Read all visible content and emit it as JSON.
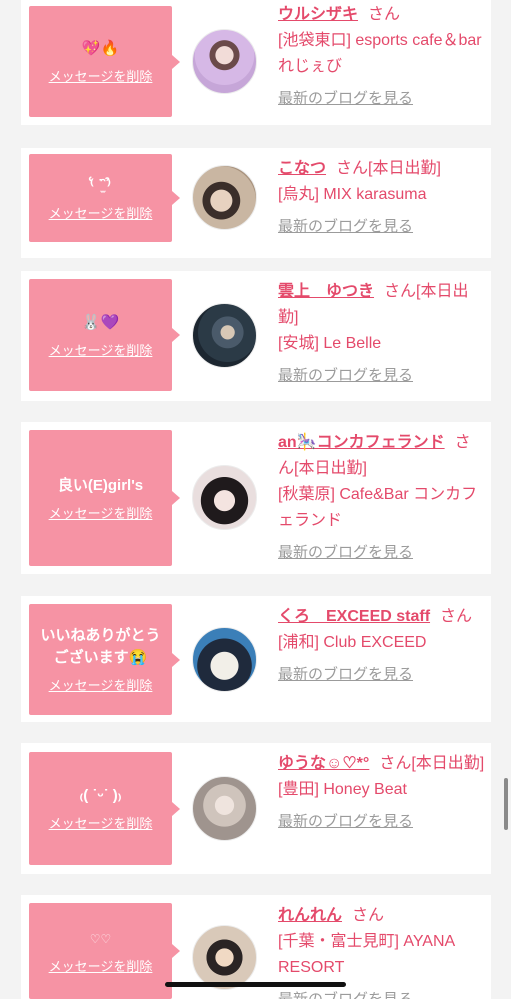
{
  "delete_label": "メッセージを削除",
  "blog_label": "最新のブログを見る",
  "suffix": "さん",
  "items": [
    {
      "message": "💖🔥",
      "name": "ウルシザキ",
      "status": "",
      "shop": "[池袋東口] esports cafe＆bar れじぇび"
    },
    {
      "message": "⁽͑ ˙̫̫̑ ⁾̉ ",
      "name": "こなつ",
      "status": "[本日出勤]",
      "shop": "[烏丸] MIX karasuma"
    },
    {
      "message": "🐰💜",
      "name": "雲上　ゆつき",
      "status": "[本日出勤]",
      "shop": "[安城] Le Belle"
    },
    {
      "message": "良い(E)girl's",
      "name": "an🎠コンカフェランド",
      "status": "[本日出勤]",
      "shop": "[秋葉原] Cafe&Bar コンカフェランド"
    },
    {
      "message": "いいねありがとう\nございます😭",
      "name": "くろ　EXCEED staff",
      "status": "",
      "shop": "[浦和] Club EXCEED"
    },
    {
      "message": "₍( ˙ᵕ˙ )₎",
      "name": "ゆうな☺︎♡*°",
      "status": "[本日出勤]",
      "shop": "[豊田] Honey Beat"
    },
    {
      "message": "♡♡",
      "name": "れんれん",
      "status": "",
      "shop": "[千葉・富士見町] AYANA RESORT"
    }
  ]
}
